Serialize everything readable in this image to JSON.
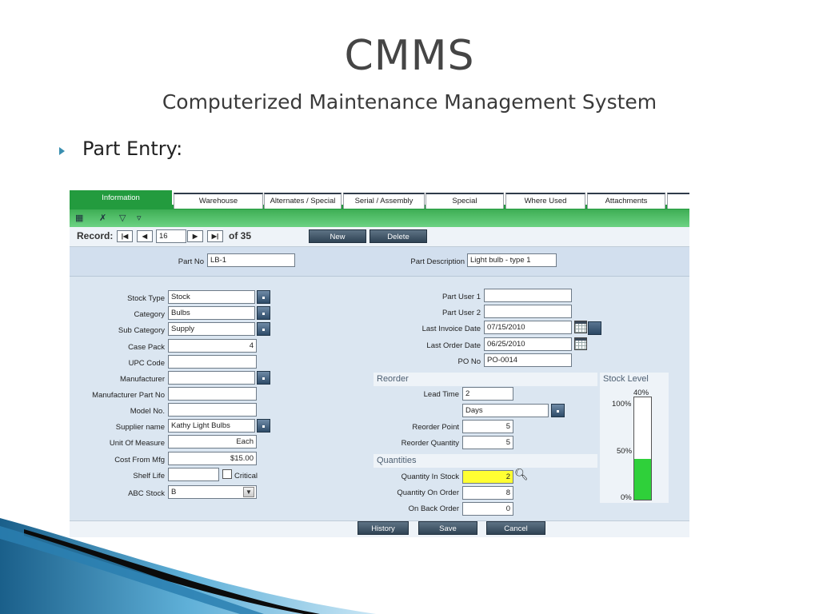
{
  "slide": {
    "title": "CMMS",
    "subtitle": "Computerized Maintenance Management System",
    "bullet": "Part Entry:"
  },
  "tabs": [
    "Information",
    "Warehouse",
    "Alternates / Special",
    "Serial / Assembly",
    "Special",
    "Where Used",
    "Attachments"
  ],
  "toolbar_icons": [
    "grid-icon",
    "filter-remove-icon",
    "filter-icon",
    "filter-apply-icon"
  ],
  "record_nav": {
    "label": "Record:",
    "first": "|◀",
    "prev": "◀",
    "current": "16",
    "next": "▶",
    "last": "▶|",
    "total": "of 35",
    "new_label": "New",
    "delete_label": "Delete"
  },
  "header_fields": {
    "part_no_label": "Part No",
    "part_no": "LB-1",
    "part_desc_label": "Part Description",
    "part_desc": "Light bulb - type 1"
  },
  "left_fields": {
    "stock_type": {
      "label": "Stock Type",
      "value": "Stock"
    },
    "category": {
      "label": "Category",
      "value": "Bulbs"
    },
    "sub_category": {
      "label": "Sub Category",
      "value": "Supply"
    },
    "case_pack": {
      "label": "Case Pack",
      "value": "4"
    },
    "upc_code": {
      "label": "UPC Code",
      "value": ""
    },
    "manufacturer": {
      "label": "Manufacturer",
      "value": ""
    },
    "manufacturer_part_no": {
      "label": "Manufacturer Part No",
      "value": ""
    },
    "model_no": {
      "label": "Model No.",
      "value": ""
    },
    "supplier_name": {
      "label": "Supplier name",
      "value": "Kathy Light Bulbs"
    },
    "unit_of_measure": {
      "label": "Unit Of Measure",
      "value": "Each"
    },
    "cost_from_mfg": {
      "label": "Cost From Mfg",
      "value": "$15.00"
    },
    "shelf_life": {
      "label": "Shelf Life",
      "value": ""
    },
    "critical_label": "Critical",
    "abc_stock": {
      "label": "ABC Stock",
      "value": "B"
    }
  },
  "right_fields": {
    "part_user_1": {
      "label": "Part User 1",
      "value": ""
    },
    "part_user_2": {
      "label": "Part User 2",
      "value": ""
    },
    "last_invoice_date": {
      "label": "Last Invoice Date",
      "value": "07/15/2010"
    },
    "last_order_date": {
      "label": "Last Order Date",
      "value": "06/25/2010"
    },
    "po_no": {
      "label": "PO No",
      "value": "PO-0014"
    }
  },
  "reorder": {
    "title": "Reorder",
    "lead_time_label": "Lead Time",
    "lead_time": "2",
    "lead_time_unit": "Days",
    "reorder_point_label": "Reorder Point",
    "reorder_point": "5",
    "reorder_qty_label": "Reorder Quantity",
    "reorder_qty": "5"
  },
  "quantities": {
    "title": "Quantities",
    "in_stock_label": "Quantity In Stock",
    "in_stock": "2",
    "on_order_label": "Quantity On Order",
    "on_order": "8",
    "back_order_label": "On Back Order",
    "back_order": "0"
  },
  "stock_level": {
    "title": "Stock Level",
    "percent_label": "40%",
    "tick_100": "100%",
    "tick_50": "50%",
    "tick_0": "0%",
    "fill_fraction": 0.4,
    "fill_color": "#2fd03a"
  },
  "footer": {
    "history_label": "History",
    "save_label": "Save",
    "cancel_label": "Cancel"
  },
  "colors": {
    "accent_green": "#239b3e",
    "highlight_yellow": "#ffff33"
  }
}
